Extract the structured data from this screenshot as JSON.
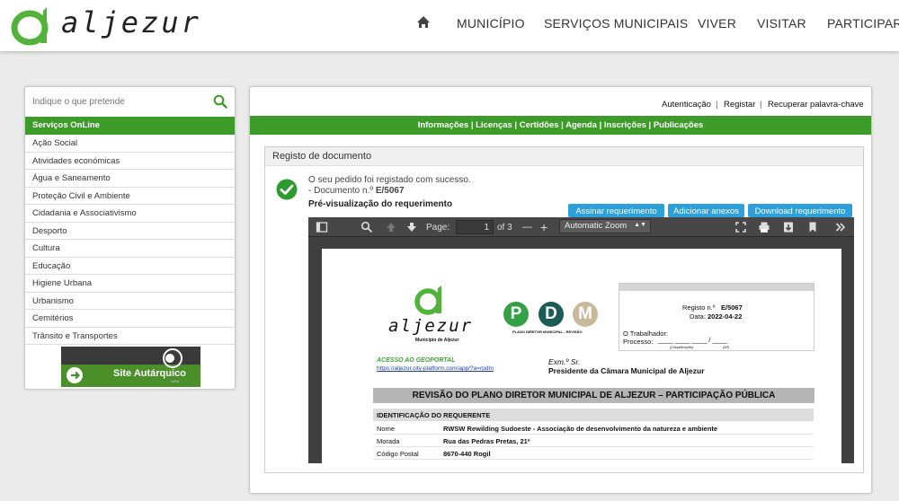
{
  "header": {
    "logo_text": "aljezur",
    "nav": [
      "MUNICÍPIO",
      "SERVIÇOS MUNICIPAIS",
      "VIVER",
      "VISITAR",
      "PARTICIPAR"
    ]
  },
  "sidebar": {
    "search_placeholder": "Indique o que pretende",
    "section_title": "Serviços OnLine",
    "items": [
      "Ação Social",
      "Atividades económicas",
      "Água e Saneamento",
      "Proteção Civil e Ambiente",
      "Cidadania e Associativismo",
      "Desporto",
      "Cultura",
      "Educação",
      "Higiene Urbana",
      "Urbanismo",
      "Cemitérios",
      "Trânsito e Transportes"
    ],
    "banner_label": "Site Autárquico",
    "banner_sub": "WEB"
  },
  "account": {
    "login": "Autenticação",
    "register": "Registar",
    "recover": "Recuperar palavra-chave",
    "sep": "|"
  },
  "services_bar": "Informações | Licenças | Certidões | Agenda | Inscrições | Publicações",
  "panel": {
    "title": "Registo de documento",
    "success_msg": "O seu pedido foi registado com sucesso.",
    "doc_prefix": "- Documento n.º",
    "doc_number": "E/5067",
    "preview_label": "Pré-visualização do requerimento",
    "buttons": {
      "sign": "Assinar requerimento",
      "attach": "Adicionar anexos",
      "download": "Download requerimento"
    }
  },
  "viewer": {
    "page_label": "Page:",
    "page_value": "1",
    "page_total": "of 3",
    "zoom_label": "Automatic Zoom",
    "minus": "—",
    "plus": "+"
  },
  "document": {
    "logo_text": "aljezur",
    "logo_sub": "Município de Aljezur",
    "pdm_letters": [
      "P",
      "D",
      "M"
    ],
    "pdm_caption": "PLANO DIRETOR MUNICIPAL - REVISÃO",
    "registo_label": "Registo n.º",
    "registo_value": "E/5067",
    "data_label": "Data:",
    "data_value": "2022-04-22",
    "trabalhador_label": "O Trabalhador:",
    "processo_label": "Processo:",
    "processo_blanks": "____ ____ ____ / ____",
    "processo_caption_a": "(Classificação)",
    "processo_caption_b": "(Nº)",
    "geoportal_label": "ACESSO AO GEOPORTAL",
    "geoportal_url": "https://aljezur.city-platform.com/app/?a=rpdm",
    "exmo": "Exm.º Sr.",
    "recipient": "Presidente da Câmara Municipal de Aljezur",
    "main_title": "REVISÃO DO PLANO DIRETOR MUNICIPAL DE ALJEZUR – PARTICIPAÇÃO PÚBLICA",
    "section": "IDENTIFICAÇÃO DO REQUERENTE",
    "rows": [
      {
        "label": "Nome",
        "value": "RWSW Rewilding Sudoeste - Associação de desenvolvimento da natureza e ambiente"
      },
      {
        "label": "Morada",
        "value": "Rua das Pedras Pretas, 21ª"
      },
      {
        "label": "Código Postal",
        "value": "8670-440 Rogil"
      }
    ]
  },
  "colors": {
    "brand_green": "#3d9b2a",
    "button_blue": "#2d9fd9"
  }
}
